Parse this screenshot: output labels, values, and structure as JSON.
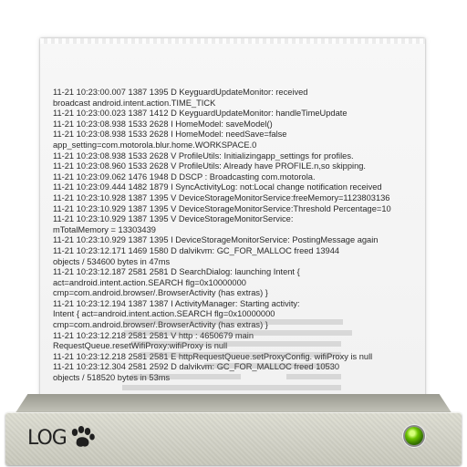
{
  "log": {
    "lines": [
      "11-21 10:23:00.007  1387   1395 D KeyguardUpdateMonitor: received",
      "broadcast android.intent.action.TIME_TICK",
      "11-21 10:23:00.023  1387   1412 D KeyguardUpdateMonitor: handleTimeUpdate",
      "11-21 10:23:08.938  1533   2628 I HomeModel: saveModel()",
      "11-21 10:23:08.938  1533   2628 I HomeModel: needSave=false",
      "app_setting=com.motorola.blur.home.WORKSPACE.0",
      "11-21 10:23:08.938  1533   2628 V ProfileUtils: Initializingapp_settings for profiles.",
      "11-21 10:23:08.960  1533   2628 V ProfileUtils: Already have PROFILE.n,so skipping.",
      "11-21 10:23:09.062  1476   1948 D DSCP     : Broadcasting com.motorola.",
      "11-21 10:23:09.444  1482   1879 I SyncActivityLog: not:Local change notification received",
      "11-21 10:23:10.928  1387   1395 V DeviceStorageMonitorService:freeMemory=1123803136",
      "11-21 10:23:10.929  1387   1395 V DeviceStorageMonitorService:Threshold Percentage=10",
      "11-21 10:23:10.929  1387   1395 V DeviceStorageMonitorService:",
      "mTotalMemory = 13303439",
      "11-21 10:23:10.929  1387   1395 I DeviceStorageMonitorService: PostingMessage again",
      "11-21 10:23:12.171  1469   1580 D dalvikvm: GC_FOR_MALLOC freed 13944",
      "objects / 534600 bytes in 47ms",
      "11-21 10:23:12.187  2581   2581 D SearchDialog: launching Intent {",
      "act=android.intent.action.SEARCH flg=0x10000000",
      "cmp=com.android.browser/.BrowserActivity (has extras) }",
      "11-21 10:23:12.194  1387   1387 I ActivityManager: Starting activity:",
      "Intent { act=android.intent.action.SEARCH flg=0x10000000",
      "cmp=com.android.browser/.BrowserActivity (has extras) }",
      "11-21 10:23:12.218  2581   2581 V http     : 4650679 main",
      "RequestQueue.resetWifiProxy:wifiProxy is null",
      "11-21 10:23:12.218  2581   2581 E httpRequestQueue.setProxyConfig. wifiProxy is null",
      "11-21 10:23:12.304  2581   2592 D dalvikvm: GC_FOR_MALLOC freed 10530",
      "objects / 518520 bytes in 53ms"
    ]
  },
  "device": {
    "logo_text": "LOG",
    "logo_icon": "paw-icon",
    "status_icon": "green-led-icon",
    "led_color": "#6cc200"
  }
}
